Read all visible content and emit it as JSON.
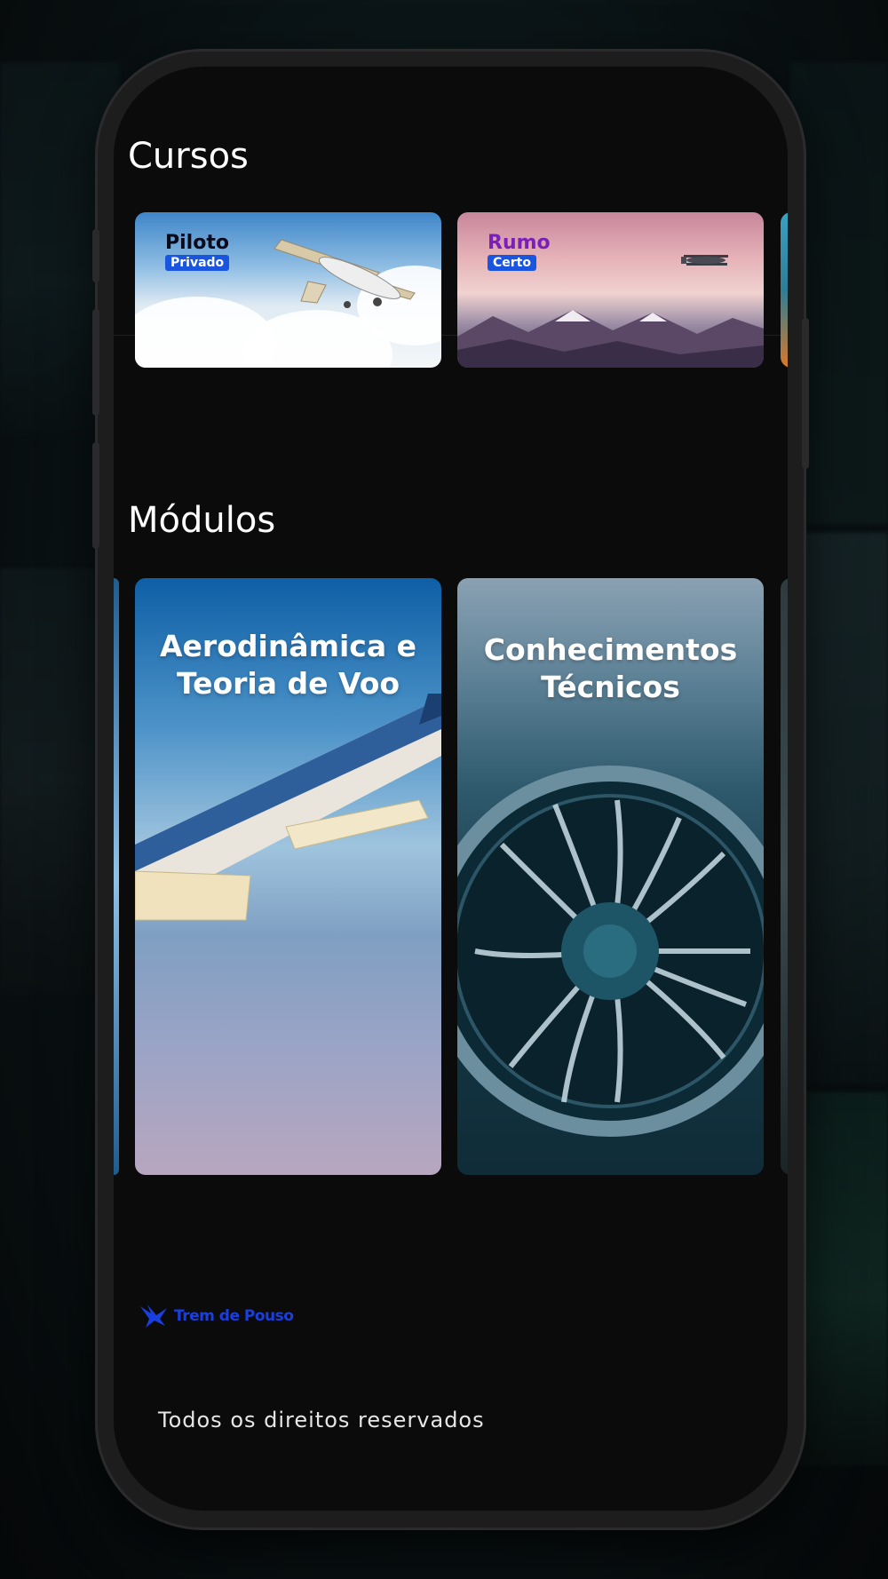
{
  "sections": {
    "cursos": {
      "title": "Cursos",
      "cards": [
        {
          "brand_top": "Piloto",
          "brand_bottom": "Privado",
          "brand_top_color": "#0a0a1a"
        },
        {
          "brand_top": "Rumo",
          "brand_bottom": "Certo",
          "brand_top_color": "#7a1fb8"
        }
      ]
    },
    "modulos": {
      "title": "Módulos",
      "cards": [
        {
          "line1": "Aerodinâmica e",
          "line2": "Teoria de Voo"
        },
        {
          "line1": "Conhecimentos",
          "line2": "Técnicos"
        }
      ]
    }
  },
  "footer": {
    "logo_text": "Trem de Pouso",
    "logo_color": "#1a3fe0",
    "copyright": "Todos os direitos reservados"
  }
}
